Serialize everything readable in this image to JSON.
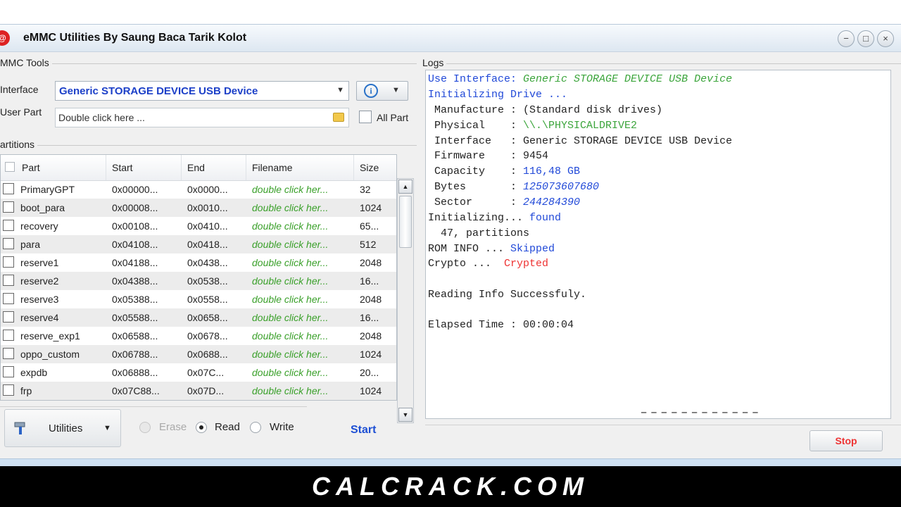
{
  "window": {
    "title": "eMMC Utilities  By Saung Baca Tarik Kolot"
  },
  "tools": {
    "group_label": "MMC Tools",
    "interface_label": "Interface",
    "interface_value": "Generic STORAGE DEVICE USB Device",
    "user_part_label": "User Part",
    "user_part_placeholder": "Double click here ...",
    "all_part_label": "All Part"
  },
  "partitions": {
    "group_label": "artitions",
    "columns": [
      "Part",
      "Start",
      "End",
      "Filename",
      "Size"
    ],
    "rows": [
      {
        "part": "PrimaryGPT",
        "start": "0x00000...",
        "end": "0x0000...",
        "filename": "double click her...",
        "size": "32"
      },
      {
        "part": "boot_para",
        "start": "0x00008...",
        "end": "0x0010...",
        "filename": "double click her...",
        "size": "1024"
      },
      {
        "part": "recovery",
        "start": "0x00108...",
        "end": "0x0410...",
        "filename": "double click her...",
        "size": "65..."
      },
      {
        "part": "para",
        "start": "0x04108...",
        "end": "0x0418...",
        "filename": "double click her...",
        "size": "512"
      },
      {
        "part": "reserve1",
        "start": "0x04188...",
        "end": "0x0438...",
        "filename": "double click her...",
        "size": "2048"
      },
      {
        "part": "reserve2",
        "start": "0x04388...",
        "end": "0x0538...",
        "filename": "double click her...",
        "size": "16..."
      },
      {
        "part": "reserve3",
        "start": "0x05388...",
        "end": "0x0558...",
        "filename": "double click her...",
        "size": "2048"
      },
      {
        "part": "reserve4",
        "start": "0x05588...",
        "end": "0x0658...",
        "filename": "double click her...",
        "size": "16..."
      },
      {
        "part": "reserve_exp1",
        "start": "0x06588...",
        "end": "0x0678...",
        "filename": "double click her...",
        "size": "2048"
      },
      {
        "part": "oppo_custom",
        "start": "0x06788...",
        "end": "0x0688...",
        "filename": "double click her...",
        "size": "1024"
      },
      {
        "part": "expdb",
        "start": "0x06888...",
        "end": "0x07C...",
        "filename": "double click her...",
        "size": "20..."
      },
      {
        "part": "frp",
        "start": "0x07C88...",
        "end": "0x07D...",
        "filename": "double click her...",
        "size": "1024"
      }
    ]
  },
  "actions": {
    "utilities_label": "Utilities",
    "erase_label": "Erase",
    "read_label": "Read",
    "write_label": "Write",
    "selected_mode": "Read",
    "start_label": "Start",
    "stop_label": "Stop"
  },
  "logs": {
    "group_label": "Logs",
    "use_interface_label": "Use Interface: ",
    "use_interface_value": "Generic STORAGE DEVICE USB Device",
    "initializing_drive": "Initializing Drive ...",
    "manufacture_label": " Manufacture : ",
    "manufacture_value": "(Standard disk drives)",
    "physical_label": " Physical    : ",
    "physical_value": "\\\\.\\PHYSICALDRIVE2",
    "interface_label": " Interface   : ",
    "interface_value": "Generic STORAGE DEVICE USB Device",
    "firmware_label": " Firmware    : ",
    "firmware_value": "9454",
    "capacity_label": " Capacity    : ",
    "capacity_value": "116,48 GB",
    "bytes_label": " Bytes       : ",
    "bytes_value": "125073607680",
    "sector_label": " Sector      : ",
    "sector_value": "244284390",
    "initializing_label": "Initializing... ",
    "initializing_value": "found",
    "partitions_count": "  47, partitions",
    "rom_info_label": "ROM INFO ... ",
    "rom_info_value": "Skipped",
    "crypto_label": "Crypto ...  ",
    "crypto_value": "Crypted",
    "reading_info": "Reading Info Successfuly.",
    "elapsed": "Elapsed Time : 00:00:04"
  },
  "banner": {
    "text": "CALCRACK.COM"
  },
  "colors": {
    "accent_blue": "#1c40c8",
    "ok_green": "#3aa02a",
    "error_red": "#e33333"
  }
}
